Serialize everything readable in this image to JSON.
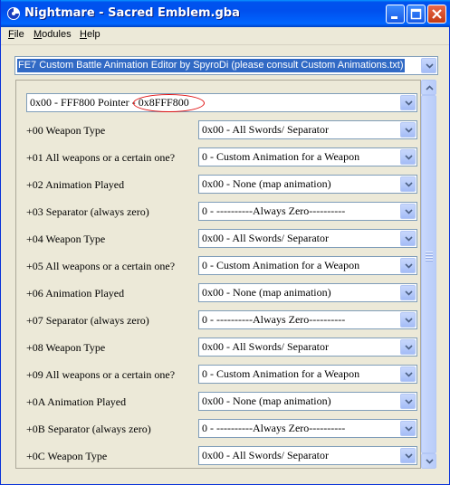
{
  "window": {
    "title": "Nightmare - Sacred Emblem.gba",
    "icon": "app-icon"
  },
  "menu": {
    "file_prefix": "F",
    "file_rest": "ile",
    "modules_prefix": "M",
    "modules_rest": "odules",
    "help_prefix": "H",
    "help_rest": "elp"
  },
  "module_selector": {
    "value": "FE7 Custom Battle Animation Editor by SpyroDi (please consult Custom Animations.txt)"
  },
  "pointer_selector": {
    "prefix": "0x00 - FFF800 Pointer - ",
    "value": "0x8FFF800"
  },
  "rows": [
    {
      "label": "+00 Weapon Type",
      "value": "0x00 - All Swords/  Separator"
    },
    {
      "label": "+01 All weapons or a certain one?",
      "value": "0 - Custom Animation for a Weapon"
    },
    {
      "label": "+02 Animation Played",
      "value": "0x00 - None (map animation)"
    },
    {
      "label": "+03 Separator (always zero)",
      "value": "0 - ----------Always Zero----------"
    },
    {
      "label": "+04 Weapon Type",
      "value": "0x00 - All Swords/  Separator"
    },
    {
      "label": "+05 All weapons or a certain one?",
      "value": "0 - Custom Animation for a Weapon"
    },
    {
      "label": "+06 Animation Played",
      "value": "0x00 - None (map animation)"
    },
    {
      "label": "+07 Separator (always zero)",
      "value": "0 - ----------Always Zero----------"
    },
    {
      "label": "+08 Weapon Type",
      "value": "0x00 - All Swords/  Separator"
    },
    {
      "label": "+09 All weapons or a certain one?",
      "value": "0 - Custom Animation for a Weapon"
    },
    {
      "label": "+0A Animation Played",
      "value": "0x00 - None (map animation)"
    },
    {
      "label": "+0B Separator (always zero)",
      "value": "0 - ----------Always Zero----------"
    },
    {
      "label": "+0C Weapon Type",
      "value": "0x00 - All Swords/  Separator"
    }
  ]
}
